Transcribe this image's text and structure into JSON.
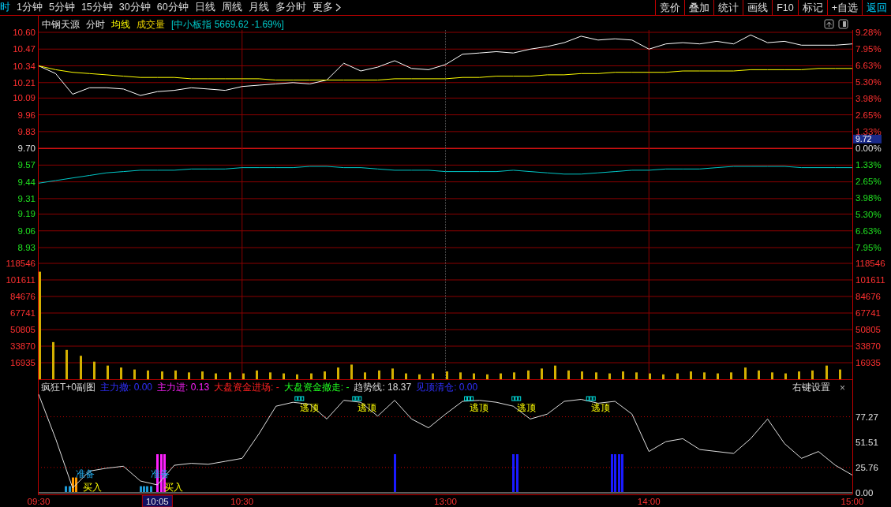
{
  "tabs": [
    {
      "label": "时",
      "selected": true
    },
    {
      "label": "1分钟",
      "selected": false
    },
    {
      "label": "5分钟",
      "selected": false
    },
    {
      "label": "15分钟",
      "selected": false
    },
    {
      "label": "30分钟",
      "selected": false
    },
    {
      "label": "60分钟",
      "selected": false
    },
    {
      "label": "日线",
      "selected": false
    },
    {
      "label": "周线",
      "selected": false
    },
    {
      "label": "月线",
      "selected": false
    },
    {
      "label": "多分时",
      "selected": false
    },
    {
      "label": "更多",
      "selected": false
    }
  ],
  "toolbar": [
    {
      "label": "竞价",
      "kind": "tool"
    },
    {
      "label": "叠加",
      "kind": "tool"
    },
    {
      "label": "统计",
      "kind": "tool"
    },
    {
      "label": "画线",
      "kind": "tool"
    },
    {
      "label": "F10",
      "kind": "tool"
    },
    {
      "label": "标记",
      "kind": "tool"
    },
    {
      "label": "+自选",
      "kind": "tool"
    },
    {
      "label": "返回",
      "kind": "back"
    }
  ],
  "legend": [
    {
      "text": "中钢天源",
      "kind": "stock"
    },
    {
      "text": "分时",
      "kind": "mode"
    },
    {
      "text": "均线",
      "kind": "average"
    },
    {
      "text": "成交量",
      "kind": "volume"
    },
    {
      "text": "[中小板指 5669.62 -1.69%]",
      "kind": "index"
    }
  ],
  "price_chart": {
    "chart_data": {
      "type": "line",
      "categories": [
        null,
        null,
        null,
        null,
        null,
        null,
        null,
        null,
        null,
        null,
        null,
        null,
        null,
        null,
        null,
        null,
        null,
        null,
        null,
        null,
        null,
        null,
        null,
        null,
        null,
        null,
        null,
        null,
        null,
        null,
        null,
        null,
        null,
        null,
        null,
        null,
        null,
        null,
        null,
        null,
        null,
        null,
        null,
        null,
        null,
        null,
        null,
        null,
        null
      ],
      "series": [
        {
          "color": "#ffffff",
          "values": [
            10.34,
            10.28,
            10.12,
            10.17,
            10.17,
            10.16,
            10.11,
            10.14,
            10.15,
            10.17,
            10.16,
            10.15,
            10.18,
            10.19,
            10.2,
            10.21,
            10.2,
            10.23,
            10.36,
            10.3,
            10.33,
            10.38,
            10.32,
            10.31,
            10.35,
            10.43,
            10.44,
            10.45,
            10.44,
            10.47,
            10.49,
            10.52,
            10.57,
            10.54,
            10.55,
            10.54,
            10.47,
            10.51,
            10.52,
            10.51,
            10.53,
            10.51,
            10.58,
            10.52,
            10.53,
            10.5,
            10.5,
            10.5,
            10.51
          ]
        },
        {
          "color": "#ffff00",
          "values": [
            10.34,
            10.31,
            10.29,
            10.28,
            10.27,
            10.26,
            10.25,
            10.25,
            10.25,
            10.24,
            10.24,
            10.24,
            10.24,
            10.24,
            10.23,
            10.23,
            10.23,
            10.23,
            10.23,
            10.23,
            10.23,
            10.24,
            10.24,
            10.24,
            10.24,
            10.25,
            10.25,
            10.26,
            10.26,
            10.26,
            10.27,
            10.27,
            10.28,
            10.28,
            10.29,
            10.29,
            10.29,
            10.29,
            10.3,
            10.3,
            10.3,
            10.3,
            10.31,
            10.31,
            10.31,
            10.31,
            10.32,
            10.32,
            10.32
          ]
        },
        {
          "color": "#00c8c8",
          "values": [
            9.43,
            9.45,
            9.47,
            9.49,
            9.51,
            9.52,
            9.53,
            9.53,
            9.53,
            9.54,
            9.54,
            9.54,
            9.55,
            9.55,
            9.55,
            9.55,
            9.56,
            9.56,
            9.55,
            9.55,
            9.54,
            9.53,
            9.53,
            9.53,
            9.52,
            9.52,
            9.52,
            9.52,
            9.53,
            9.52,
            9.51,
            9.5,
            9.5,
            9.51,
            9.52,
            9.53,
            9.53,
            9.54,
            9.54,
            9.54,
            9.55,
            9.56,
            9.56,
            9.56,
            9.56,
            9.55,
            9.55,
            9.55,
            9.55
          ]
        }
      ],
      "ylim": [
        8.93,
        10.6
      ],
      "yticks": [
        {
          "value": 10.6,
          "label": "10.60"
        },
        {
          "value": 10.47,
          "label": "10.47"
        },
        {
          "value": 10.34,
          "label": "10.34"
        },
        {
          "value": 10.21,
          "label": "10.21"
        },
        {
          "value": 10.09,
          "label": "10.09"
        },
        {
          "value": 9.96,
          "label": "9.96"
        },
        {
          "value": 9.83,
          "label": "9.83"
        },
        {
          "value": 9.7,
          "label": "9.70"
        },
        {
          "value": 9.57,
          "label": "9.57"
        },
        {
          "value": 9.44,
          "label": "9.44"
        },
        {
          "value": 9.31,
          "label": "9.31"
        },
        {
          "value": 9.19,
          "label": "9.19"
        },
        {
          "value": 9.06,
          "label": "9.06"
        },
        {
          "value": 8.93,
          "label": "8.93"
        }
      ]
    },
    "right_ticks": [
      {
        "label": "9.28%",
        "kind": "up"
      },
      {
        "label": "7.95%",
        "kind": "up"
      },
      {
        "label": "6.63%",
        "kind": "up"
      },
      {
        "label": "5.30%",
        "kind": "up"
      },
      {
        "label": "3.98%",
        "kind": "up"
      },
      {
        "label": "2.65%",
        "kind": "up"
      },
      {
        "label": "1.33%",
        "kind": "up"
      },
      {
        "label": "0.00%",
        "kind": "flat"
      },
      {
        "label": "1.33%",
        "kind": "down"
      },
      {
        "label": "2.65%",
        "kind": "down"
      },
      {
        "label": "3.98%",
        "kind": "down"
      },
      {
        "label": "5.30%",
        "kind": "down"
      },
      {
        "label": "6.63%",
        "kind": "down"
      },
      {
        "label": "7.95%",
        "kind": "down"
      }
    ],
    "last_price": {
      "label": "9.72"
    }
  },
  "volume_chart": {
    "chart_data": {
      "type": "bar",
      "categories": [
        null,
        null,
        null,
        null,
        null,
        null,
        null,
        null,
        null,
        null,
        null,
        null,
        null,
        null,
        null,
        null,
        null,
        null,
        null,
        null,
        null,
        null,
        null,
        null,
        null,
        null,
        null,
        null,
        null,
        null,
        null,
        null,
        null,
        null,
        null,
        null,
        null,
        null,
        null,
        null,
        null,
        null,
        null,
        null,
        null,
        null,
        null,
        null,
        null,
        null,
        null,
        null,
        null,
        null,
        null,
        null,
        null,
        null,
        null,
        null
      ],
      "series": [
        {
          "color": "#d4b000",
          "values": [
            110000,
            38000,
            30000,
            24000,
            18000,
            14000,
            12000,
            10000,
            9000,
            8000,
            9000,
            7000,
            8000,
            6000,
            7000,
            6000,
            9000,
            7000,
            6000,
            5000,
            6000,
            8000,
            12000,
            15000,
            7000,
            9000,
            11000,
            6000,
            5000,
            6000,
            8000,
            7000,
            6000,
            5000,
            6000,
            7000,
            9000,
            11000,
            14000,
            9000,
            8000,
            7000,
            6000,
            8000,
            7000,
            6000,
            5000,
            6000,
            8000,
            7000,
            6000,
            7000,
            12000,
            9000,
            7000,
            6000,
            8000,
            9000,
            14000,
            10000
          ]
        }
      ],
      "ylim": [
        0,
        118546
      ],
      "yticks": [
        {
          "value": 118546,
          "label": "118546"
        },
        {
          "value": 101611,
          "label": "101611"
        },
        {
          "value": 84676,
          "label": "84676"
        },
        {
          "value": 67741,
          "label": "67741"
        },
        {
          "value": 50805,
          "label": "50805"
        },
        {
          "value": 33870,
          "label": "33870"
        },
        {
          "value": 16935,
          "label": "16935"
        }
      ]
    }
  },
  "indicator": {
    "title": "疯狂T+0副图",
    "readings": [
      {
        "text": "主力撤: 0.00",
        "kind": "withdraw"
      },
      {
        "text": "主力进: 0.13",
        "kind": "inflow"
      },
      {
        "text": "大盘资金进场: -",
        "kind": "market_in"
      },
      {
        "text": "大盘资金撤走: -",
        "kind": "market_out"
      },
      {
        "text": "趋势线: 18.37",
        "kind": "trend"
      },
      {
        "text": "见顶清仓: 0.00",
        "kind": "top"
      }
    ],
    "settings": "右键设置",
    "close": "×",
    "chart_data": {
      "type": "line",
      "categories": [
        "09:30",
        null,
        null,
        null,
        null,
        null,
        null,
        null,
        null,
        null,
        null,
        null,
        "10:30",
        null,
        null,
        null,
        null,
        null,
        null,
        null,
        null,
        null,
        null,
        null,
        "13:00",
        null,
        null,
        null,
        null,
        null,
        null,
        null,
        null,
        null,
        null,
        null,
        "14:00",
        null,
        null,
        null,
        null,
        null,
        null,
        null,
        null,
        null,
        null,
        null,
        "15:00"
      ],
      "series": [
        {
          "color": "#e0e0e0",
          "values": [
            100,
            55,
            5,
            22,
            25,
            27,
            12,
            8,
            28,
            30,
            29,
            32,
            35,
            60,
            88,
            92,
            90,
            75,
            94,
            92,
            78,
            94,
            75,
            66,
            80,
            93,
            94,
            92,
            88,
            75,
            80,
            93,
            95,
            91,
            93,
            80,
            42,
            52,
            55,
            44,
            42,
            40,
            55,
            75,
            50,
            35,
            42,
            28,
            18
          ]
        }
      ],
      "ylim": [
        0,
        115
      ],
      "yticks": [
        {
          "value": 77.27,
          "label": "77.27"
        },
        {
          "value": 51.51,
          "label": "51.51"
        },
        {
          "value": 25.76,
          "label": "25.76"
        },
        {
          "value": 0,
          "label": "0.00"
        }
      ]
    },
    "signals": [
      {
        "text": "准备",
        "kind": "ready"
      },
      {
        "text": "买入",
        "kind": "buy"
      },
      {
        "text": "准备",
        "kind": "ready"
      },
      {
        "text": "买入",
        "kind": "buy"
      },
      {
        "text": "逃顶",
        "kind": "top"
      },
      {
        "text": "逃顶",
        "kind": "top"
      },
      {
        "text": "逃顶",
        "kind": "top"
      },
      {
        "text": "逃顶",
        "kind": "top"
      },
      {
        "text": "逃顶",
        "kind": "top"
      }
    ],
    "cursor": {
      "label": "10:05"
    }
  }
}
